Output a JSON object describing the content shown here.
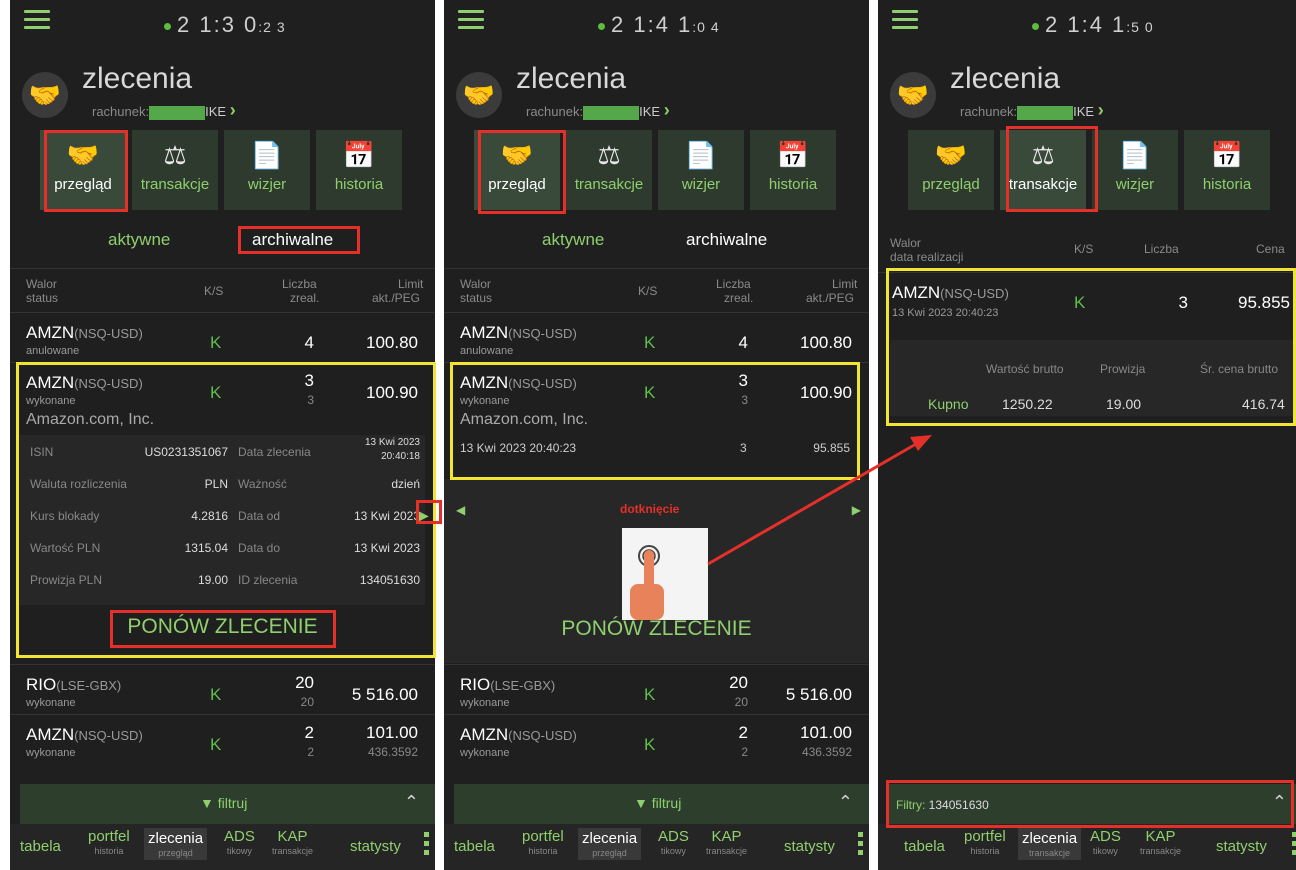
{
  "clock_main": [
    "2 1:3 0",
    "2 1:4 1",
    "2 1:4 1"
  ],
  "clock_sec": [
    ":2 3",
    ":0 4",
    ":5 0"
  ],
  "screen_title": "zlecenia",
  "account_label": "rachunek:",
  "account_suffix": "IKE",
  "tabs": [
    "przegląd",
    "transakcje",
    "wizjer",
    "historia"
  ],
  "subtabs": {
    "active": "aktywne",
    "archive": "archiwalne"
  },
  "orders_header": {
    "walor": "Walor",
    "status": "status",
    "ks": "K/S",
    "liczba": "Liczba",
    "zreal": "zreal.",
    "limit": "Limit",
    "akt_peg": "akt./PEG"
  },
  "orders": [
    {
      "sym": "AMZN",
      "mkt": "(NSQ-USD)",
      "status": "anulowane",
      "ks": "K",
      "qty": "4",
      "qty2": "",
      "limit": "100.80",
      "limit2": ""
    },
    {
      "sym": "AMZN",
      "mkt": "(NSQ-USD)",
      "status": "wykonane",
      "ks": "K",
      "qty": "3",
      "qty2": "3",
      "limit": "100.90",
      "limit2": ""
    },
    {
      "sym": "RIO",
      "mkt": "(LSE-GBX)",
      "status": "wykonane",
      "ks": "K",
      "qty": "20",
      "qty2": "20",
      "limit": "5 516.00",
      "limit2": ""
    },
    {
      "sym": "AMZN",
      "mkt": "(NSQ-USD)",
      "status": "wykonane",
      "ks": "K",
      "qty": "2",
      "qty2": "2",
      "limit": "101.00",
      "limit2": "436.3592"
    }
  ],
  "company": "Amazon.com, Inc.",
  "details": {
    "isin_l": "ISIN",
    "isin_v": "US0231351067",
    "data_zlecenia_l": "Data zlecenia",
    "data_zlecenia_v1": "13 Kwi 2023",
    "data_zlecenia_v2": "20:40:18",
    "waluta_l": "Waluta rozliczenia",
    "waluta_v": "PLN",
    "waznosc_l": "Ważność",
    "waznosc_v": "dzień",
    "kurs_l": "Kurs blokady",
    "kurs_v": "4.2816",
    "data_od_l": "Data od",
    "data_od_v": "13 Kwi 2023",
    "wartosc_l": "Wartość PLN",
    "wartosc_v": "1315.04",
    "data_do_l": "Data do",
    "data_do_v": "13 Kwi 2023",
    "prowizja_l": "Prowizja PLN",
    "prowizja_v": "19.00",
    "id_l": "ID zlecenia",
    "id_v": "134051630"
  },
  "renew_button": "PONÓW ZLECENIE",
  "trade_line": {
    "date": "13 Kwi 2023 20:40:23",
    "qty": "3",
    "price": "95.855"
  },
  "tap_label": "dotknięcie",
  "filter_label": "filtruj",
  "filter_value_label": "Filtry:",
  "filter_value": "134051630",
  "tx_header": {
    "walor": "Walor",
    "data": "data realizacji",
    "ks": "K/S",
    "liczba": "Liczba",
    "cena": "Cena"
  },
  "tx_row": {
    "sym": "AMZN",
    "mkt": "(NSQ-USD)",
    "date": "13 Kwi 2023 20:40:23",
    "ks": "K",
    "qty": "3",
    "price": "95.855"
  },
  "tx_detail_header": {
    "wartosc": "Wartość brutto",
    "prowizja": "Prowizja",
    "sr_cena": "Śr. cena brutto"
  },
  "tx_detail": {
    "type": "Kupno",
    "wartosc": "1250.22",
    "prowizja": "19.00",
    "sr_cena": "416.74"
  },
  "bottom_nav": [
    {
      "label": "tabela",
      "sub": ""
    },
    {
      "label": "portfel",
      "sub": "historia"
    },
    {
      "label": "zlecenia",
      "sub": "przegląd",
      "sub_tx": "transakcje"
    },
    {
      "label": "ADS",
      "sub": "tikowy"
    },
    {
      "label": "KAP",
      "sub": "transakcje"
    },
    {
      "label": "statysty",
      "sub": ""
    }
  ],
  "colors": {
    "accent": "#8fcf6e",
    "buy": "#5fbf4a",
    "highlight_red": "#e5302a",
    "highlight_yellow": "#f2e531"
  }
}
